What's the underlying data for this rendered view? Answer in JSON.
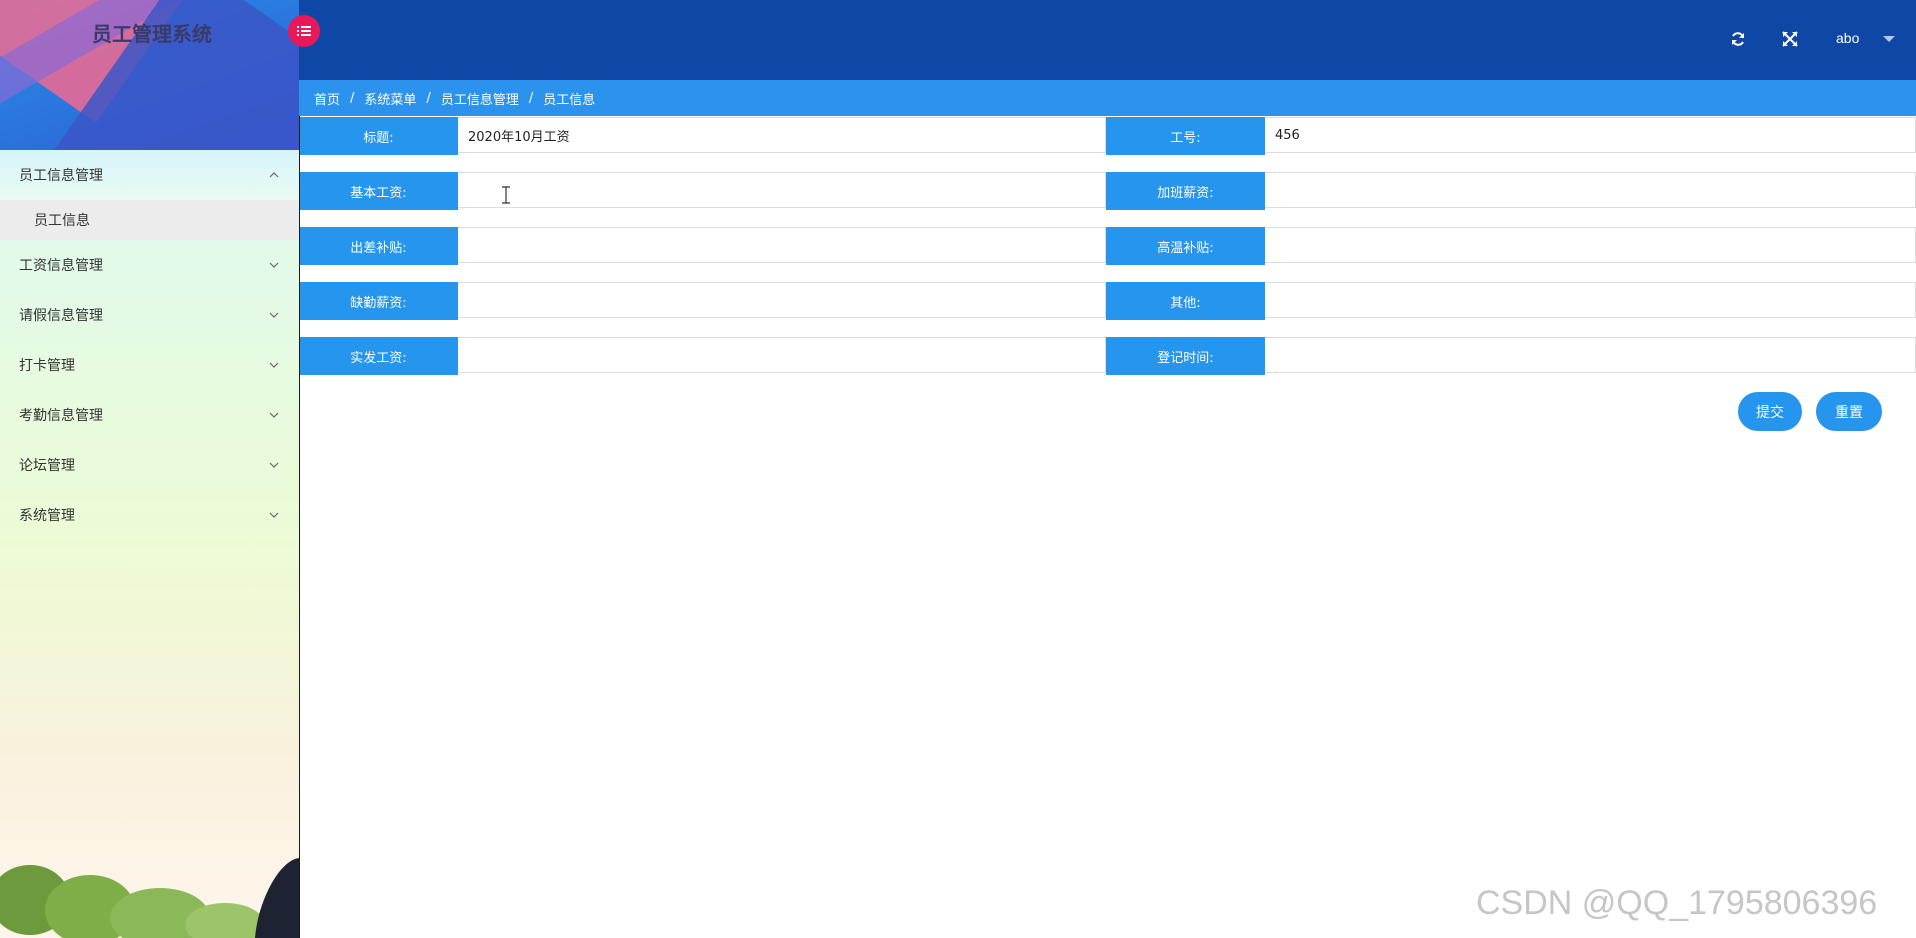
{
  "app": {
    "title": "员工管理系统"
  },
  "sidebar": {
    "menu": [
      {
        "label": "员工信息管理",
        "expanded": true,
        "children": [
          {
            "label": "员工信息"
          }
        ]
      },
      {
        "label": "工资信息管理",
        "expanded": false
      },
      {
        "label": "请假信息管理",
        "expanded": false
      },
      {
        "label": "打卡管理",
        "expanded": false
      },
      {
        "label": "考勤信息管理",
        "expanded": false
      },
      {
        "label": "论坛管理",
        "expanded": false
      },
      {
        "label": "系统管理",
        "expanded": false
      }
    ]
  },
  "topbar": {
    "icons": [
      "menu-collapse-icon",
      "refresh-icon",
      "fullscreen-icon"
    ],
    "user_name": "abo",
    "bg_color": "#0f47a6",
    "collapse_color": "#e8185b"
  },
  "breadcrumb": [
    "首页",
    "系统菜单",
    "员工信息管理",
    "员工信息"
  ],
  "form": {
    "rows": [
      {
        "left": {
          "label": "标题:",
          "value": "2020年10月工资"
        },
        "right": {
          "label": "工号:",
          "value": "456"
        }
      },
      {
        "left": {
          "label": "基本工资:",
          "value": ""
        },
        "right": {
          "label": "加班薪资:",
          "value": ""
        }
      },
      {
        "left": {
          "label": "出差补贴:",
          "value": ""
        },
        "right": {
          "label": "高温补贴:",
          "value": ""
        }
      },
      {
        "left": {
          "label": "缺勤薪资:",
          "value": ""
        },
        "right": {
          "label": "其他:",
          "value": ""
        }
      },
      {
        "left": {
          "label": "实发工资:",
          "value": ""
        },
        "right": {
          "label": "登记时间:",
          "value": ""
        }
      }
    ],
    "submit_label": "提交",
    "reset_label": "重置",
    "accent_color": "#2595ee"
  },
  "watermark": "CSDN @QQ_1795806396"
}
